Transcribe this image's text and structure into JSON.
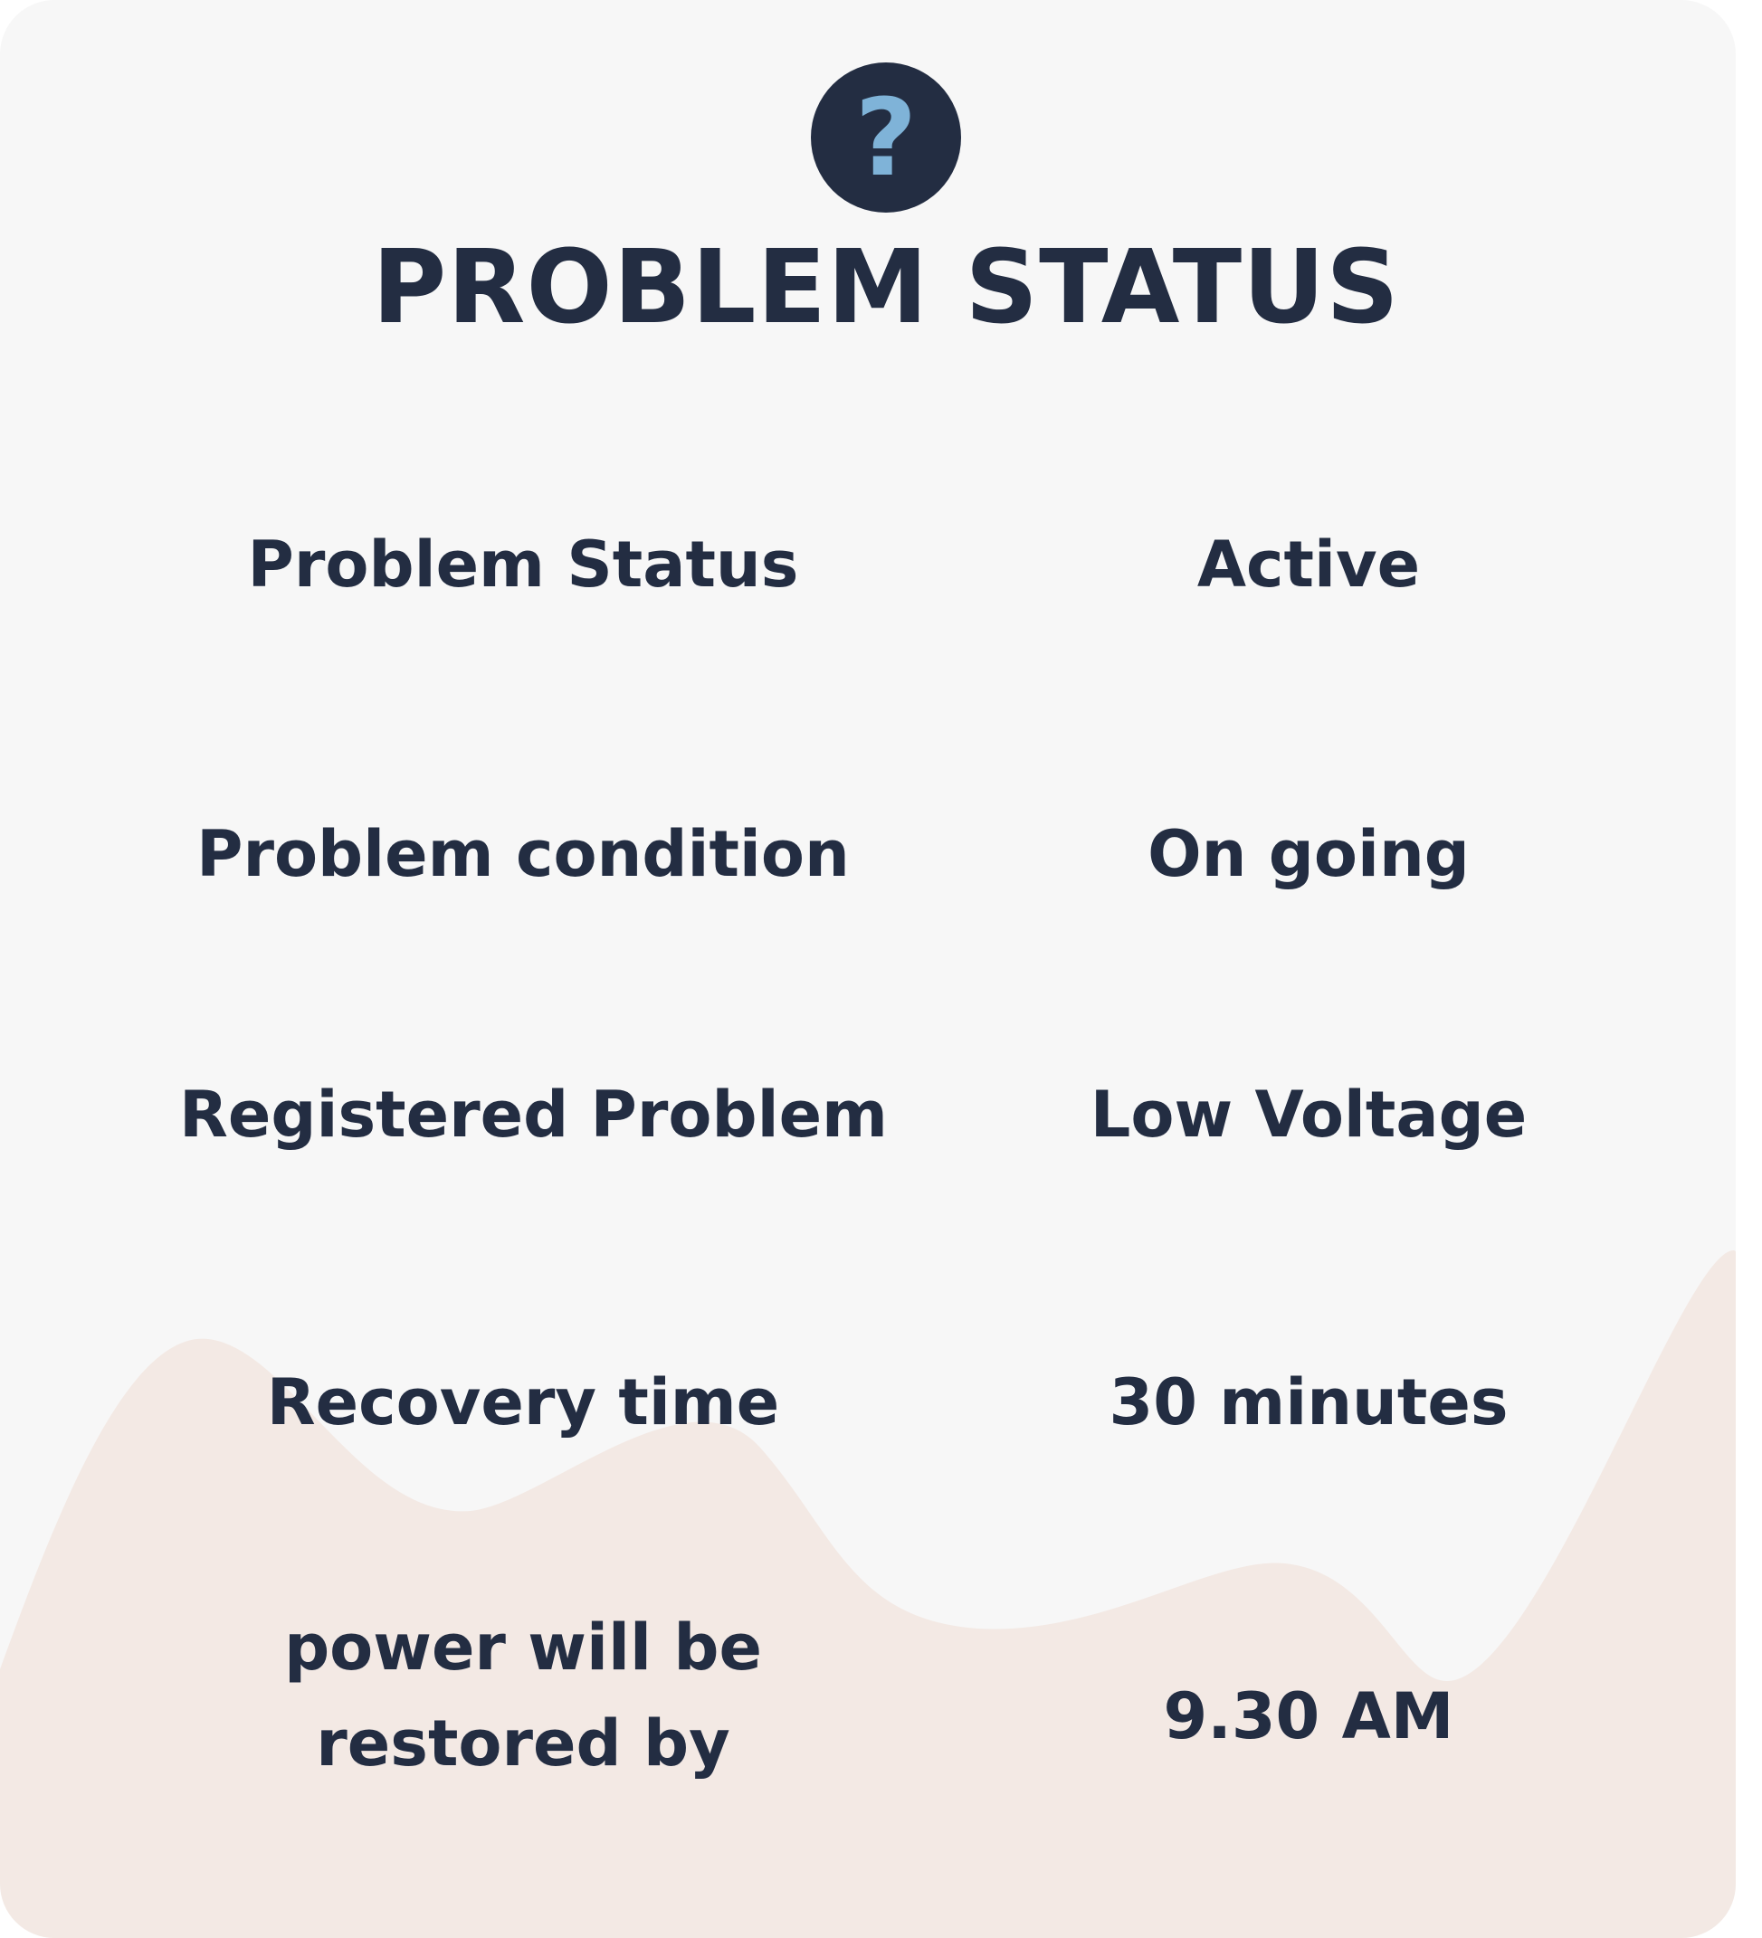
{
  "card": {
    "title": "PROBLEM STATUS",
    "help_icon_glyph": "?",
    "colors": {
      "background": "#f7f7f7",
      "text": "#232d42",
      "badge": "#232d42",
      "badge_glyph": "#7fb3d8",
      "wave": "#f3e9e4"
    },
    "rows": [
      {
        "label": "Problem Status",
        "value": "Active"
      },
      {
        "label": "Problem condition",
        "value": "On going"
      },
      {
        "label": "Registered Problem",
        "value": "Low Voltage"
      },
      {
        "label": "Recovery time",
        "value": "30 minutes"
      },
      {
        "label_line1": "power will be",
        "label_line2": "restored by",
        "value": "9.30 AM"
      }
    ]
  }
}
